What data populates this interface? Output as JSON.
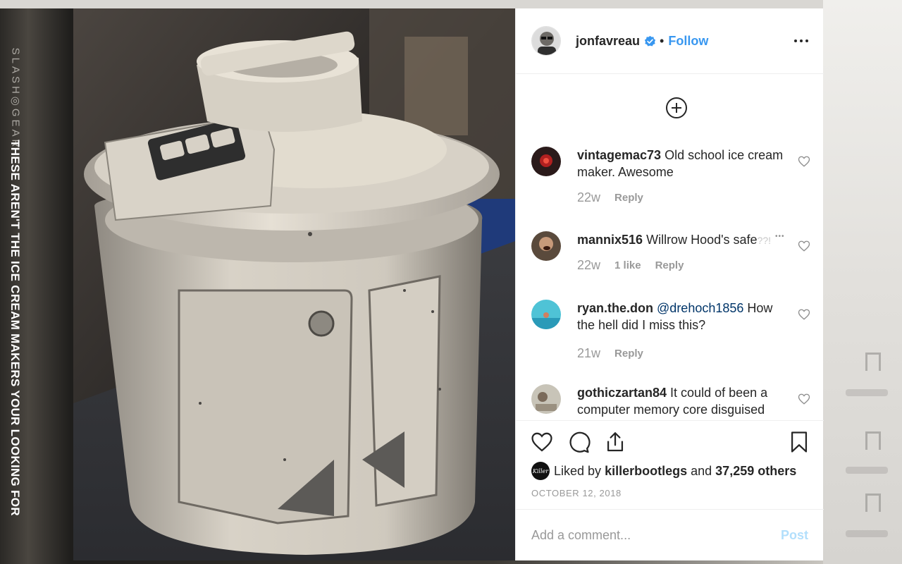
{
  "watermark": {
    "brand": "SLASH◎GEAR"
  },
  "side_caption": "THESE AREN'T THE ICE CREAM MAKERS YOUR LOOKING FOR",
  "post": {
    "author": {
      "username": "jonfavreau",
      "verified": true,
      "follow_label": "Follow",
      "separator": "•"
    },
    "comments": [
      {
        "username": "vintagemac73",
        "text": "Old school ice cream maker. Awesome",
        "age": "22w",
        "likes": "",
        "reply": "Reply"
      },
      {
        "username": "mannix516",
        "text": "Willrow Hood's safe",
        "trail": "??!",
        "ellipsis": "•••",
        "age": "22w",
        "likes": "1 like",
        "reply": "Reply"
      },
      {
        "username": "ryan.the.don",
        "mention": "@drehoch1856",
        "text": "How the hell did I miss this?",
        "age": "21w",
        "likes": "",
        "reply": "Reply"
      },
      {
        "username": "gothiczartan84",
        "text": "It could of been a computer memory core disguised"
      }
    ],
    "liked_by_prefix": "Liked by",
    "liked_by_user": "killerbootlegs",
    "liked_by_and": "and",
    "liked_by_others": "37,259 others",
    "liker_avatar_text": "Killer",
    "date": "OCTOBER 12, 2018",
    "comment_placeholder": "Add a comment...",
    "post_label": "Post"
  },
  "colors": {
    "link": "#3897f0",
    "verified": "#3897f0",
    "post_disabled": "#b2dffc",
    "muted": "#999999"
  },
  "icons": [
    "add-circle-icon",
    "heart-icon",
    "comment-icon",
    "share-icon",
    "bookmark-icon",
    "more-icon",
    "verified-icon"
  ]
}
